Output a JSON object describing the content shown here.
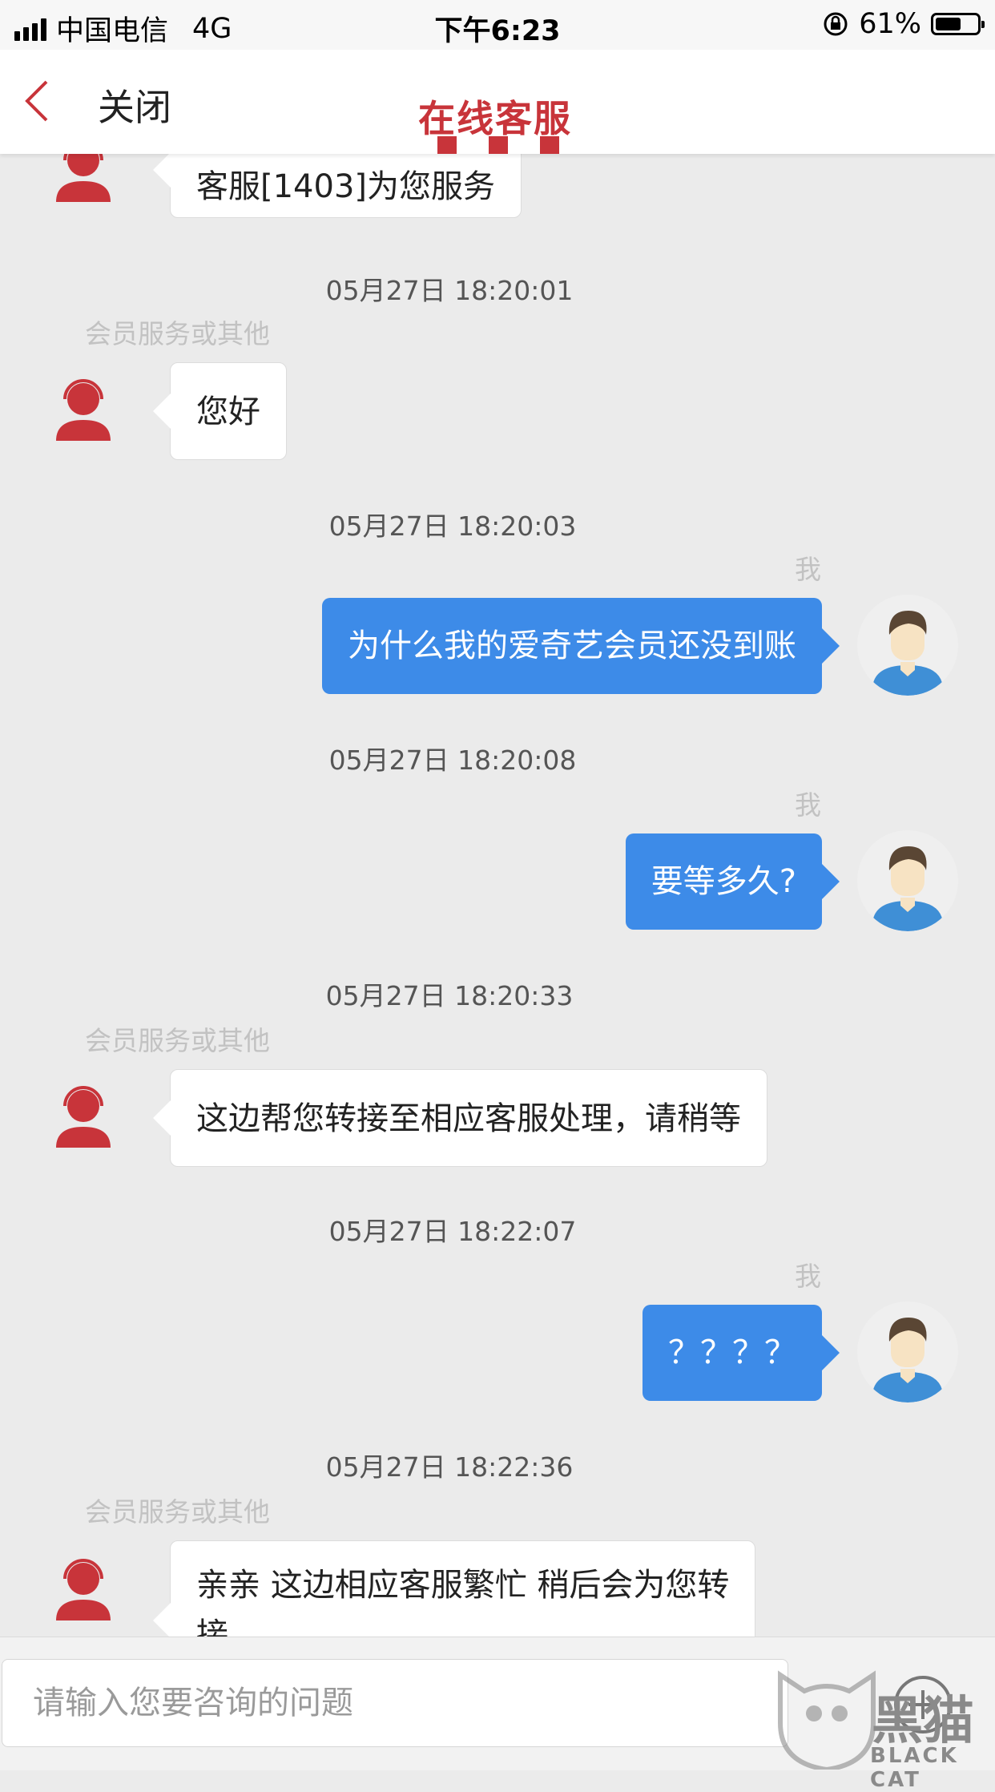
{
  "status_bar": {
    "carrier": "中国电信",
    "network": "4G",
    "time": "下午6:23",
    "battery": "61%",
    "battery_level": 0.61
  },
  "nav": {
    "close_label": "关闭",
    "title": "在线客服"
  },
  "messages": [
    {
      "side": "agent",
      "text": "客服[1403]为您服务"
    },
    {
      "timestamp": "05月27日 18:20:01",
      "sender": "会员服务或其他",
      "side": "agent",
      "text": "您好"
    },
    {
      "timestamp": "05月27日 18:20:03",
      "sender": "我",
      "side": "user",
      "text": "为什么我的爱奇艺会员还没到账"
    },
    {
      "timestamp": "05月27日 18:20:08",
      "sender": "我",
      "side": "user",
      "text": "要等多久?"
    },
    {
      "timestamp": "05月27日 18:20:33",
      "sender": "会员服务或其他",
      "side": "agent",
      "text": "这边帮您转接至相应客服处理，请稍等"
    },
    {
      "timestamp": "05月27日 18:22:07",
      "sender": "我",
      "side": "user",
      "text": "？？？？"
    },
    {
      "timestamp": "05月27日 18:22:36",
      "sender": "会员服务或其他",
      "side": "agent",
      "text": "亲亲 这边相应客服繁忙 稍后会为您转",
      "text_cont": "接"
    }
  ],
  "input": {
    "placeholder": "请输入您要咨询的问题"
  },
  "watermark": {
    "cn": "黑猫",
    "en": "BLACK CAT"
  },
  "colors": {
    "accent_red": "#c8343a",
    "user_bubble": "#3d8be8",
    "background": "#ebebeb"
  }
}
